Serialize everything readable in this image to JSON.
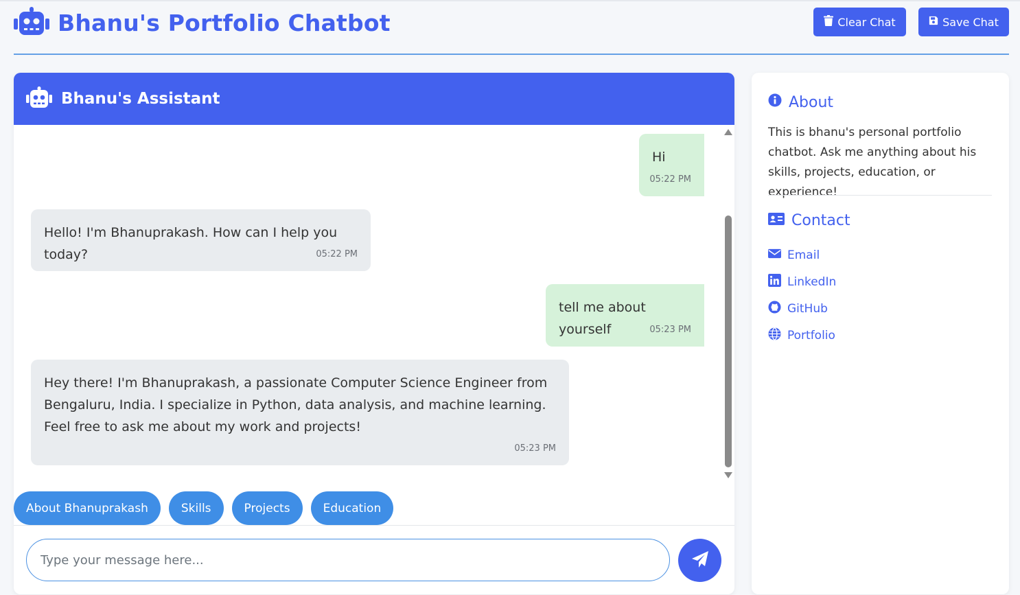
{
  "app": {
    "title": "Bhanu's Portfolio Chatbot",
    "accent_color": "#4361ee",
    "brand_icon": "robot-icon"
  },
  "toolbar": {
    "clear_label": "Clear Chat",
    "clear_icon": "trash-icon",
    "save_label": "Save Chat",
    "save_icon": "floppy-disk-icon"
  },
  "chat": {
    "header_title": "Bhanu's Assistant",
    "header_icon": "robot-icon",
    "messages": [
      {
        "sender": "user",
        "text": "Hi",
        "time": "05:22 PM"
      },
      {
        "sender": "bot",
        "text": "Hello! I'm Bhanuprakash. How can I help you today?",
        "time": "05:22 PM"
      },
      {
        "sender": "user",
        "text": "tell me about yourself",
        "time": "05:23 PM"
      },
      {
        "sender": "bot",
        "text": "Hey there! I'm Bhanuprakash, a passionate Computer Science Engineer from Bengaluru, India. I specialize in Python, data analysis, and machine learning. Feel free to ask me about my work and projects!",
        "time": "05:23 PM"
      }
    ],
    "user_bubble_color": "#d6f2da",
    "bot_bubble_color": "#e9ecef",
    "quick_replies": [
      "About Bhanuprakash",
      "Skills",
      "Projects",
      "Education"
    ],
    "input": {
      "value": "",
      "placeholder": "Type your message here..."
    },
    "send_icon": "paper-plane-icon"
  },
  "sidebar": {
    "about": {
      "title": "About",
      "icon": "info-circle-icon",
      "text": "This is bhanu's personal portfolio chatbot. Ask me anything about his skills, projects, education, or experience!"
    },
    "contact": {
      "title": "Contact",
      "icon": "id-card-icon",
      "links": [
        {
          "label": "Email",
          "icon": "envelope-icon"
        },
        {
          "label": "LinkedIn",
          "icon": "linkedin-icon"
        },
        {
          "label": "GitHub",
          "icon": "github-icon"
        },
        {
          "label": "Portfolio",
          "icon": "globe-icon"
        }
      ]
    }
  }
}
